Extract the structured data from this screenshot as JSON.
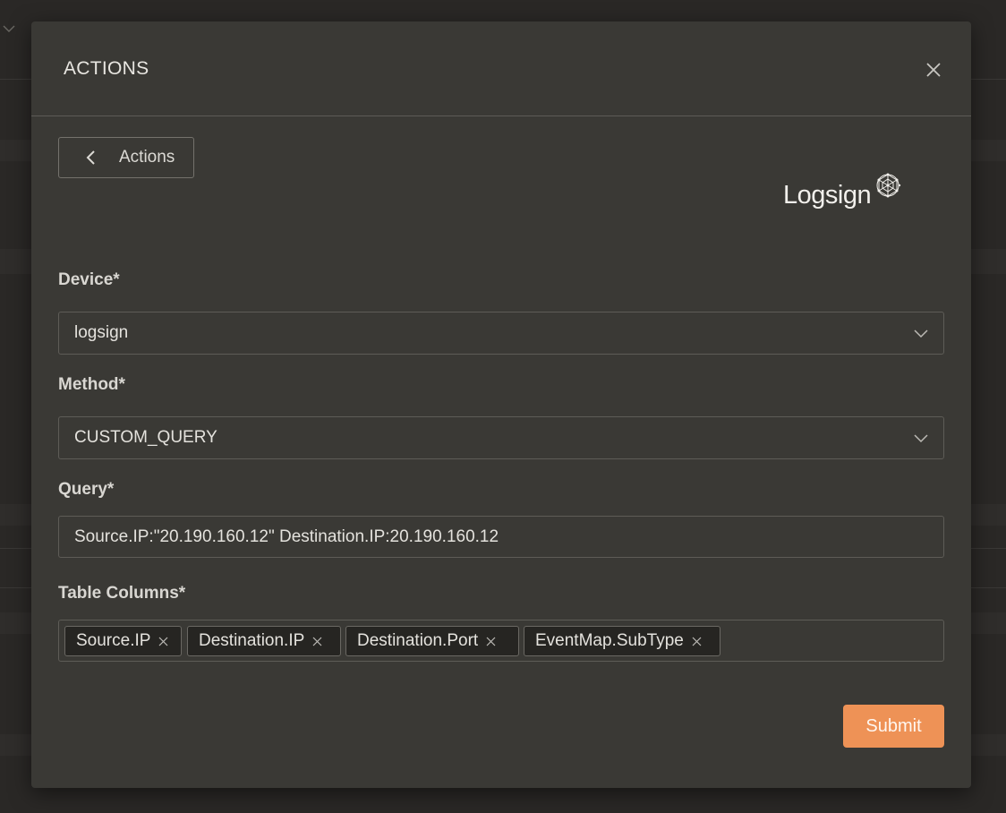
{
  "modal": {
    "title": "ACTIONS",
    "back_label": "Actions",
    "logo_text": "Logsign",
    "submit_label": "Submit"
  },
  "fields": {
    "device": {
      "label": "Device*",
      "value": "logsign"
    },
    "method": {
      "label": "Method*",
      "value": "CUSTOM_QUERY"
    },
    "query": {
      "label": "Query*",
      "value": "Source.IP:\"20.190.160.12\" Destination.IP:20.190.160.12"
    },
    "table_columns": {
      "label": "Table Columns*",
      "tags": [
        "Source.IP",
        "Destination.IP",
        "Destination.Port",
        "EventMap.SubType"
      ]
    }
  },
  "colors": {
    "accent": "#ee9256",
    "modal_bg": "#3a3935",
    "page_bg": "#2a2826"
  },
  "icons": {
    "close": "close-icon",
    "back": "chevron-left-icon",
    "dropdown": "chevron-down-icon",
    "tag_remove": "x-icon",
    "logo": "logsign-logo"
  }
}
